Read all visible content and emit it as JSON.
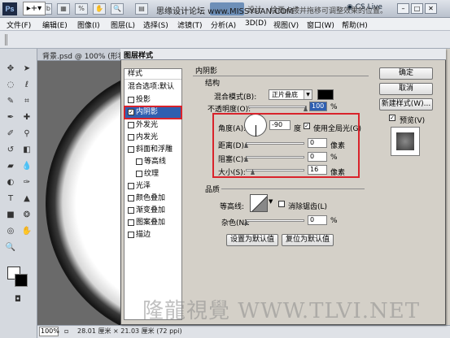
{
  "app": {
    "logo": "Ps",
    "cs_live": "CS Live",
    "workspace_tab": "基本功能",
    "watermark_top": "思缘设计论坛 www.MISSYUAN.COM"
  },
  "menu": [
    "文件(F)",
    "编辑(E)",
    "图像(I)",
    "图层(L)",
    "选择(S)",
    "滤镜(T)",
    "分析(A)",
    "3D(D)",
    "视图(V)",
    "窗口(W)",
    "帮助(H)"
  ],
  "options": {
    "hint": "点按并拖移可调整效果的位置。"
  },
  "document": {
    "tab_title": "背景.psd @ 100% (形状",
    "zoom": "100%",
    "info": "28.01 厘米 × 21.03 厘米 (72 ppi)"
  },
  "dialog": {
    "title": "图层样式",
    "styles_header": "样式",
    "style_items": [
      {
        "label": "混合选项:默认",
        "checkbox": false,
        "sub": false
      },
      {
        "label": "投影",
        "checkbox": true,
        "checked": false,
        "sub": false
      },
      {
        "label": "内阴影",
        "checkbox": true,
        "checked": true,
        "sub": false,
        "selected": true
      },
      {
        "label": "外发光",
        "checkbox": true,
        "checked": false,
        "sub": false
      },
      {
        "label": "内发光",
        "checkbox": true,
        "checked": false,
        "sub": false
      },
      {
        "label": "斜面和浮雕",
        "checkbox": true,
        "checked": false,
        "sub": false
      },
      {
        "label": "等高线",
        "checkbox": true,
        "checked": false,
        "sub": true
      },
      {
        "label": "纹理",
        "checkbox": true,
        "checked": false,
        "sub": true
      },
      {
        "label": "光泽",
        "checkbox": true,
        "checked": false,
        "sub": false
      },
      {
        "label": "颜色叠加",
        "checkbox": true,
        "checked": false,
        "sub": false
      },
      {
        "label": "渐变叠加",
        "checkbox": true,
        "checked": false,
        "sub": false
      },
      {
        "label": "图案叠加",
        "checkbox": true,
        "checked": false,
        "sub": false
      },
      {
        "label": "描边",
        "checkbox": true,
        "checked": false,
        "sub": false
      }
    ],
    "section_title": "内阴影",
    "structure": {
      "title": "结构",
      "blend_mode_label": "混合模式(B):",
      "blend_mode_value": "正片叠底",
      "shadow_color": "#000000",
      "opacity_label": "不透明度(O):",
      "opacity_value": "100",
      "opacity_unit": "%",
      "angle_label": "角度(A):",
      "angle_value": "-90",
      "angle_unit": "度",
      "global_light_label": "使用全局光(G)",
      "global_light_checked": true,
      "distance_label": "距离(D):",
      "distance_value": "0",
      "distance_unit": "像素",
      "choke_label": "阻塞(C):",
      "choke_value": "0",
      "choke_unit": "%",
      "size_label": "大小(S):",
      "size_value": "16",
      "size_unit": "像素"
    },
    "quality": {
      "title": "品质",
      "contour_label": "等高线:",
      "anti_alias_label": "消除锯齿(L)",
      "anti_alias_checked": false,
      "noise_label": "杂色(N):",
      "noise_value": "0",
      "noise_unit": "%"
    },
    "buttons": {
      "set_default": "设置为默认值",
      "reset_default": "复位为默认值",
      "ok": "确定",
      "cancel": "取消",
      "new_style": "新建样式(W)...",
      "preview_label": "预览(V)",
      "preview_checked": true
    }
  },
  "watermark_bottom": "隆龍視覺 WWW.TLVI.NET",
  "accent": {
    "highlight_red": "#d9232b",
    "selection_blue": "#2f5fb0"
  }
}
